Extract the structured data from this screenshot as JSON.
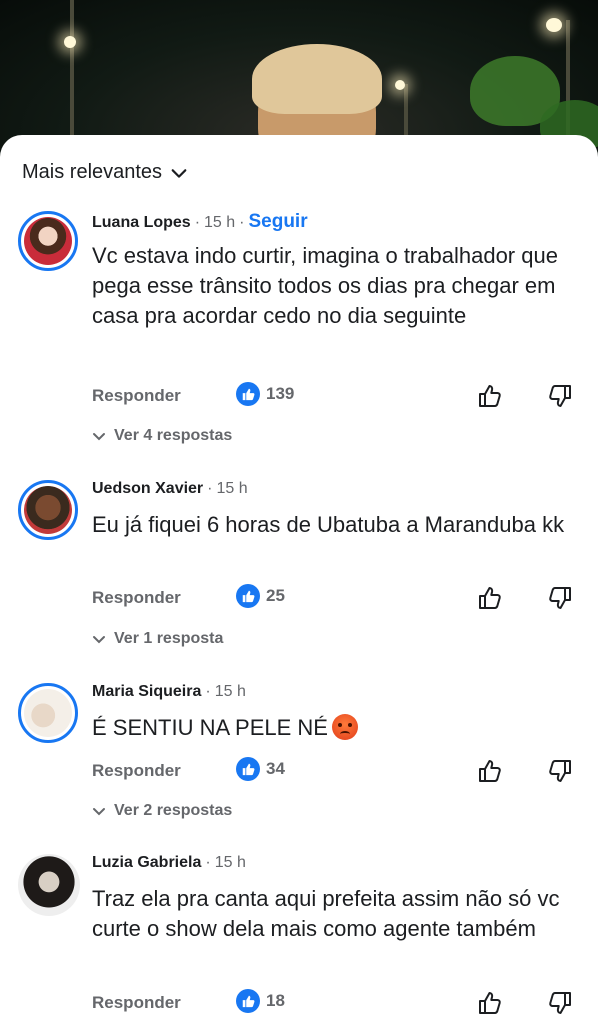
{
  "sort": {
    "label": "Mais relevantes"
  },
  "comments": [
    {
      "author": "Luana Lopes",
      "time": "15 h",
      "follow": "Seguir",
      "text": "Vc estava indo curtir, imagina o trabalhador que pega esse trânsito todos os dias pra chegar em casa pra acordar cedo no dia seguinte",
      "reply_label": "Responder",
      "likes": "139",
      "replies_label": "Ver 4 respostas"
    },
    {
      "author": "Uedson Xavier",
      "time": "15 h",
      "text": "Eu já fiquei 6 horas de Ubatuba a Maranduba kk",
      "reply_label": "Responder",
      "likes": "25",
      "replies_label": "Ver 1 resposta"
    },
    {
      "author": "Maria Siqueira",
      "time": "15 h",
      "text": "É SENTIU NA PELE NÉ",
      "emoji": "angry-face-emoji",
      "reply_label": "Responder",
      "likes": "34",
      "replies_label": "Ver 2 respostas"
    },
    {
      "author": "Luzia Gabriela",
      "time": "15 h",
      "text": "Traz ela pra canta aqui prefeita assim não só vc curte o show dela mais como agente também",
      "reply_label": "Responder",
      "likes": "18"
    }
  ],
  "colors": {
    "accent": "#1877f2",
    "muted": "#65676b",
    "text": "#1c1e21"
  },
  "icons": [
    "chevron-down-icon",
    "like-icon",
    "thumb-up-icon",
    "thumb-down-icon",
    "angry-face-emoji"
  ]
}
